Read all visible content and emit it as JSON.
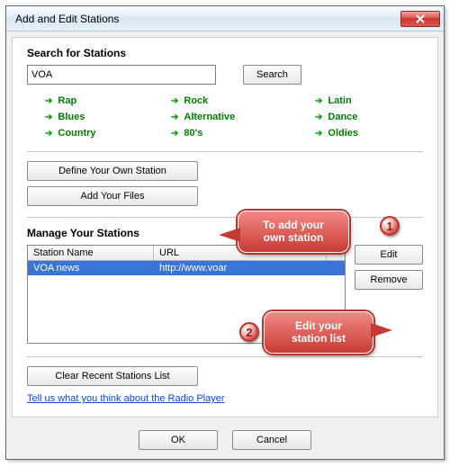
{
  "window": {
    "title": "Add and Edit Stations"
  },
  "search": {
    "heading": "Search for Stations",
    "value": "VOA",
    "button": "Search"
  },
  "genres": [
    "Rap",
    "Rock",
    "Latin",
    "Blues",
    "Alternative",
    "Dance",
    "Country",
    "80's",
    "Oldies"
  ],
  "buttons": {
    "define_station": "Define Your Own Station",
    "add_files": "Add Your Files",
    "edit": "Edit",
    "remove": "Remove",
    "clear": "Clear Recent Stations List",
    "ok": "OK",
    "cancel": "Cancel"
  },
  "manage": {
    "heading": "Manage Your Stations",
    "columns": {
      "name": "Station Name",
      "url": "URL"
    },
    "rows": [
      {
        "name": "VOA news",
        "url": "http://www.voar"
      }
    ]
  },
  "feedback": "Tell us what you think about the Radio Player",
  "callouts": {
    "c1_line1": "To add your",
    "c1_line2": "own station",
    "c2_line1": "Edit your",
    "c2_line2": "station list",
    "n1": "1",
    "n2": "2"
  }
}
